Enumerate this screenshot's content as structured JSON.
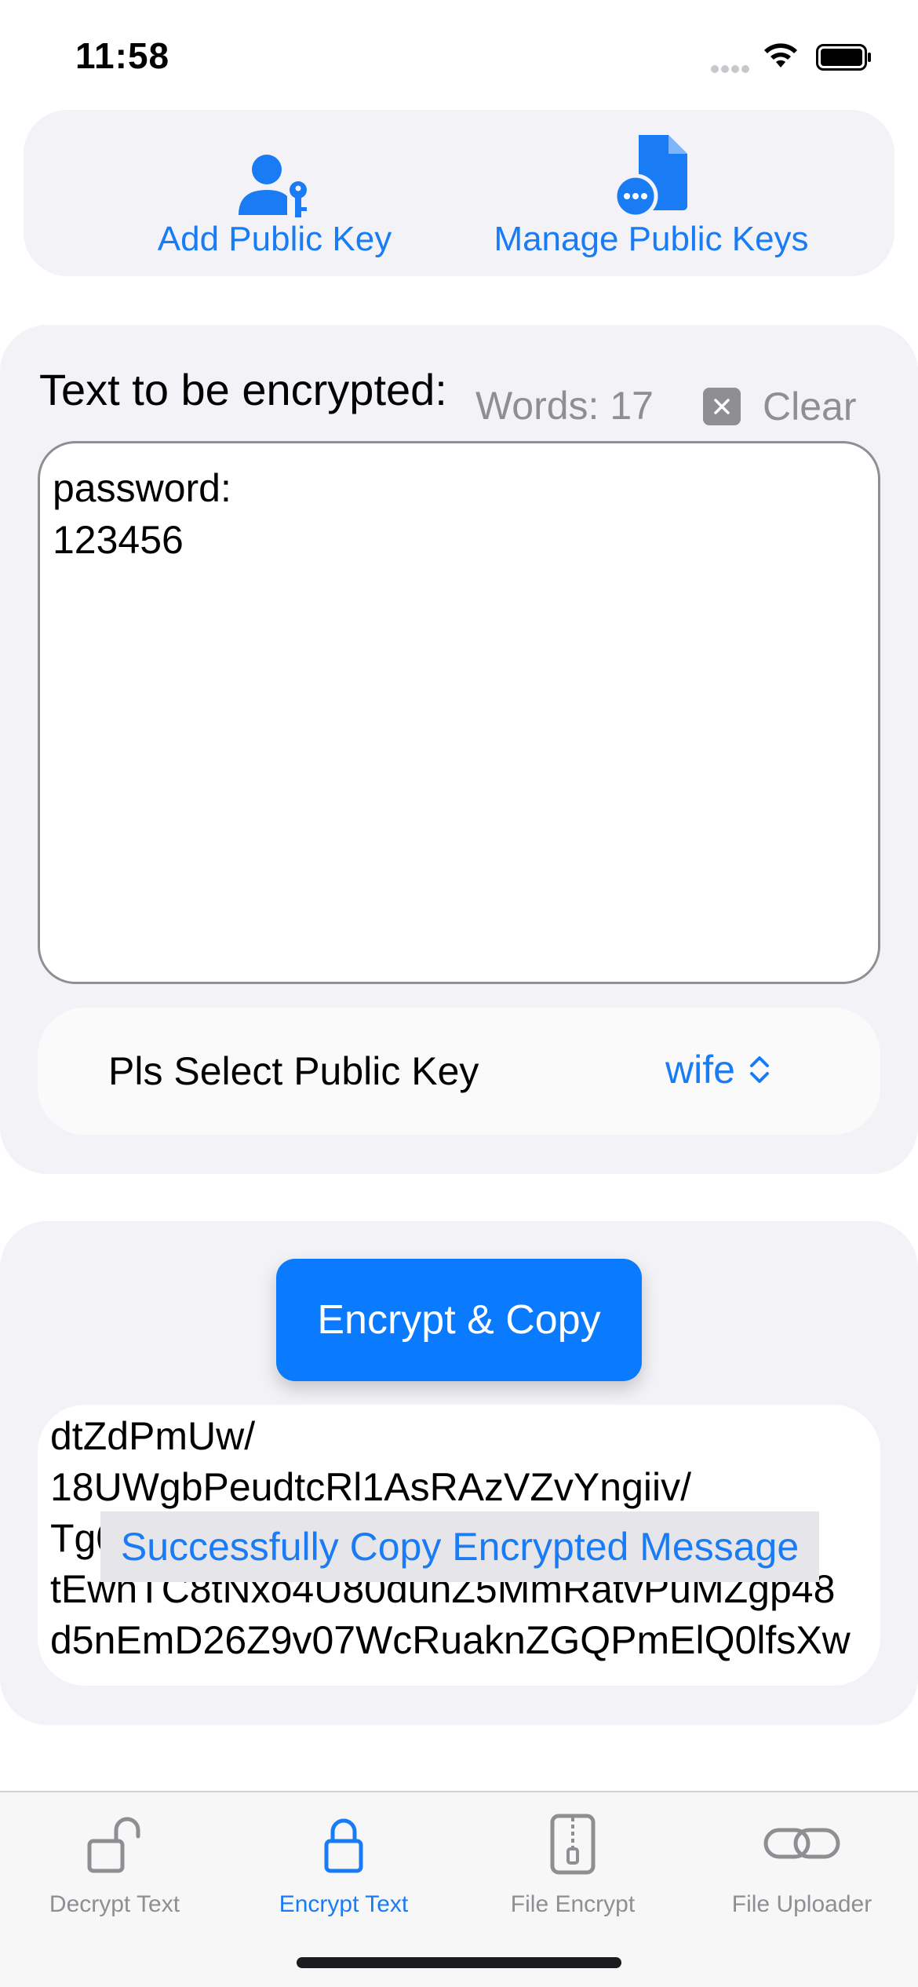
{
  "status_bar": {
    "time": "11:58"
  },
  "top_actions": {
    "add_public_key": "Add Public Key",
    "manage_public_keys": "Manage Public Keys"
  },
  "input_section": {
    "title": "Text to be encrypted:",
    "word_count": "Words: 17",
    "clear_label": "Clear",
    "text_value": "password:\n123456",
    "key_picker_label": "Pls Select Public Key",
    "key_picker_value": "wife"
  },
  "output_section": {
    "encrypt_button": "Encrypt & Copy",
    "encrypted_lines": [
      "dtZdPmUw/",
      "18UWgbPeudtcRl1AsRAzVZvYngiiv/",
      "Tg0",
      "tEwnTC8tNxo4U80duhZ5MmRatvPuMZgp48",
      "d5nEmD26Z9v07WcRuaknZGQPmElQ0lfsXw"
    ],
    "toast": "Successfully Copy Encrypted Message"
  },
  "tab_bar": {
    "tabs": [
      {
        "label": "Decrypt Text",
        "icon": "unlock-icon",
        "active": false
      },
      {
        "label": "Encrypt Text",
        "icon": "lock-icon",
        "active": true
      },
      {
        "label": "File Encrypt",
        "icon": "zipper-file-icon",
        "active": false
      },
      {
        "label": "File Uploader",
        "icon": "link-icon",
        "active": false
      }
    ]
  },
  "colors": {
    "accent": "#1a7cf5",
    "button": "#0a7bff",
    "muted": "#8e8e93",
    "panel": "#f2f2f7"
  }
}
